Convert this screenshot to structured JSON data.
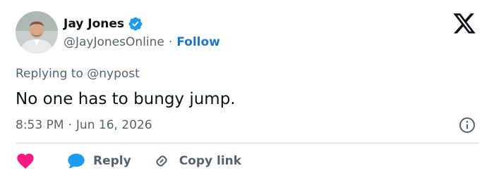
{
  "author": {
    "display_name": "Jay Jones",
    "handle": "@JayJonesOnline",
    "separator": "·",
    "follow_label": "Follow"
  },
  "reply_to": {
    "prefix": "Replying to",
    "handle": "@nypost"
  },
  "tweet": {
    "text": "No one has to bungy jump.",
    "time": "8:53 PM",
    "separator": "·",
    "date": "Jun 16, 2026"
  },
  "actions": {
    "reply_label": "Reply",
    "copy_link_label": "Copy link"
  },
  "colors": {
    "verified_badge": "#1d9bf0",
    "follow_link": "#1d77c8",
    "heart": "#f91880",
    "reply_bubble": "#1d9bf0",
    "secondary_text": "#536471"
  },
  "icons": [
    "x-logo-icon",
    "verified-badge-icon",
    "info-icon",
    "heart-icon",
    "reply-bubble-icon",
    "link-icon"
  ]
}
